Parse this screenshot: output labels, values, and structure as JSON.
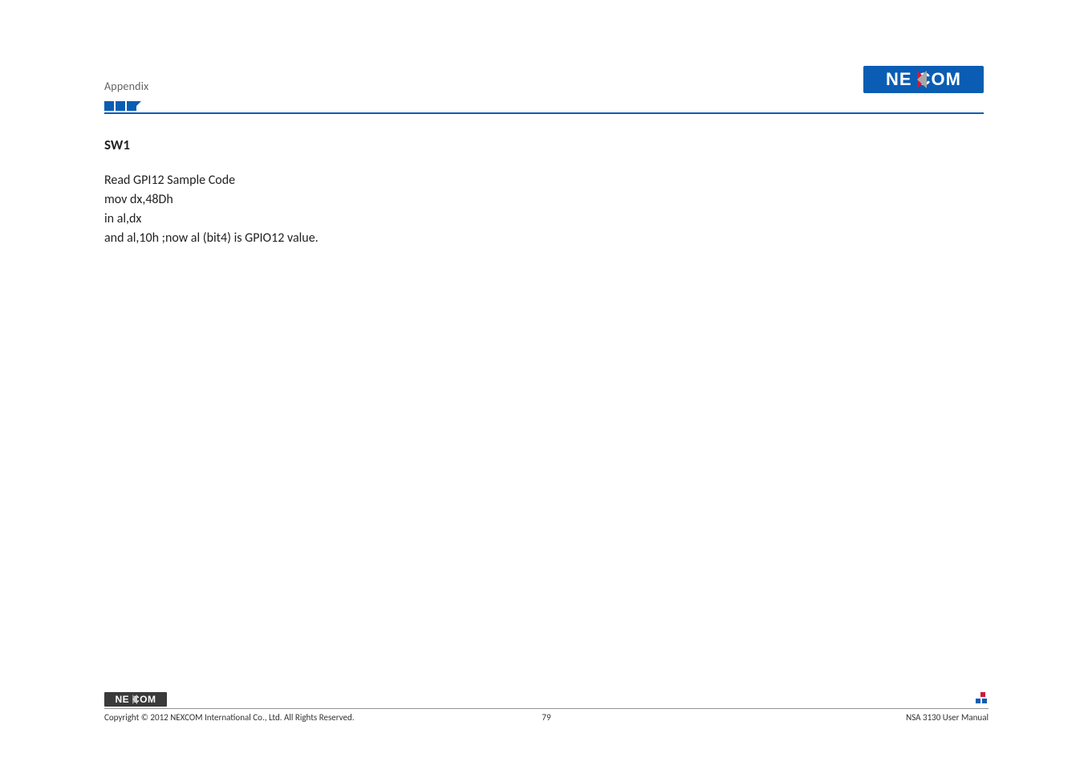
{
  "header": {
    "section_label": "Appendix",
    "brand": "NEXCOM"
  },
  "content": {
    "heading": "SW1",
    "lines": [
      "Read GPI12 Sample Code",
      "mov dx,48Dh",
      "in al,dx",
      "and al,10h ;now al (bit4) is GPIO12 value."
    ]
  },
  "footer": {
    "brand": "NEXCOM",
    "copyright": "Copyright © 2012 NEXCOM International Co., Ltd. All Rights Reserved.",
    "page_number": "79",
    "manual_title": "NSA 3130 User Manual"
  }
}
